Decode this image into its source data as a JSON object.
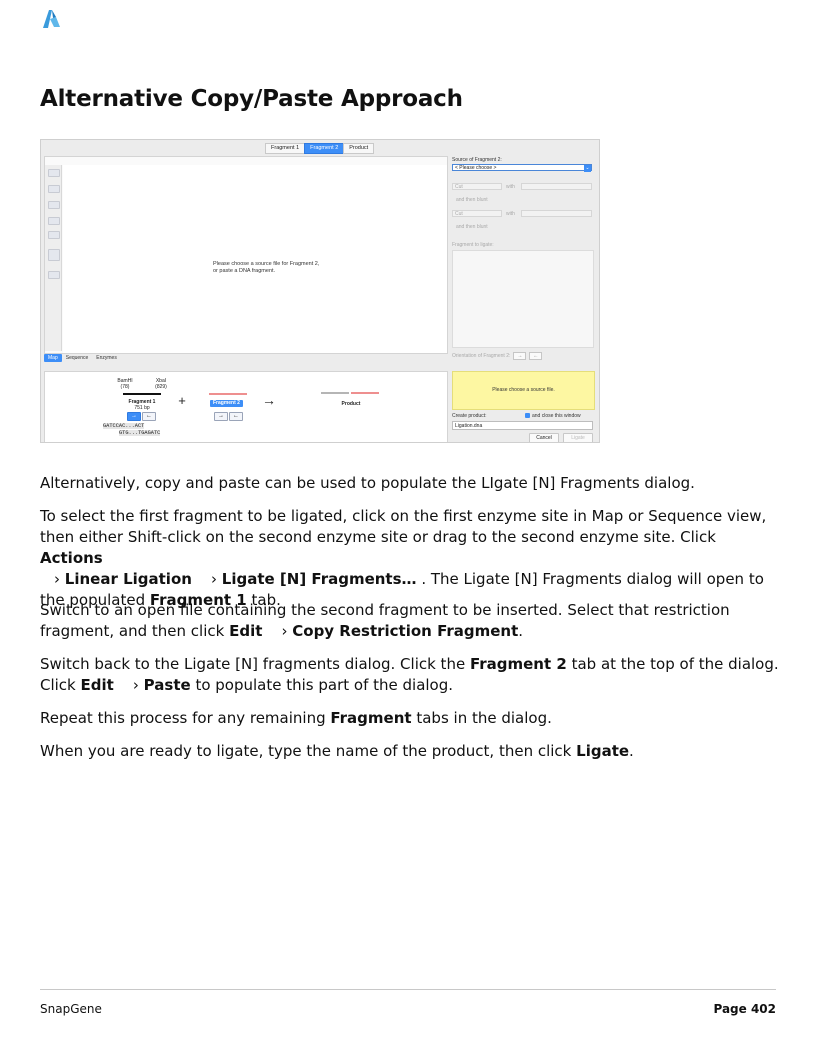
{
  "heading": "Alternative Copy/Paste Approach",
  "screenshot": {
    "tabs": [
      "Fragment 1",
      "Fragment 2",
      "Product"
    ],
    "active_tab": "Fragment 2",
    "empty_message_line1": "Please choose a source file for Fragment 2,",
    "empty_message_line2": "or paste a DNA fragment.",
    "view_tabs": [
      "Map",
      "Sequence",
      "Enzymes"
    ],
    "source_label": "Source of Fragment 2:",
    "source_select": "< Please choose >",
    "cut_label": "Cut",
    "with_label": "with",
    "blunt_label": "and then blunt",
    "fragment_to_ligate_label": "Fragment to ligate:",
    "orientation_label": "Orientation of Fragment 2:",
    "enzyme_left": "BamHI",
    "enzyme_left_pos": "(78)",
    "enzyme_right": "XbaI",
    "enzyme_right_pos": "(829)",
    "fragment1_label": "Fragment 1",
    "fragment1_size": "751 bp",
    "seq_top": "GATCCAC...ACT",
    "seq_bottom": "GTG...TGAGATC",
    "plus": "+",
    "fragment2_label": "Fragment 2",
    "arrow": "→",
    "product_label": "Product",
    "source_prompt": "Please choose a source file.",
    "create_product_label": "Create product:",
    "close_window_label": "and close this window",
    "product_name": "Ligation.dna",
    "cancel_button": "Cancel",
    "ligate_button": "Ligate"
  },
  "paragraphs": {
    "p1": "Alternatively, copy and paste can be used to populate the LIgate [N] Fragments dialog.",
    "p2_a": "To select the first fragment to be ligated, click on the first enzyme site in Map or Sequence view, then either Shift-click on the second enzyme site or drag to the second enzyme site. Click ",
    "p2_actions": "Actions",
    "p2_linear": "Linear Ligation",
    "p2_ligate": "Ligate [N] Fragments…",
    "p2_b": ". The Ligate [N] Fragments dialog will open to the populated ",
    "p2_frag1": "Fragment 1",
    "p2_c": " tab.",
    "p3_a": "Switch to an open file containing the second fragment to be inserted. Select that restriction fragment, and then click ",
    "p3_edit": "Edit",
    "p3_copy": "Copy Restriction Fragment",
    "p3_b": ".",
    "p4_a": "Switch back to the Ligate [N] fragments dialog. Click the ",
    "p4_frag2": "Fragment 2",
    "p4_b": " tab at the top of the dialog. Click ",
    "p4_edit": "Edit",
    "p4_paste": "Paste",
    "p4_c": " to populate this part of the dialog.",
    "p5_a": "Repeat this process for any remaining ",
    "p5_frag": "Fragment",
    "p5_b": " tabs in the dialog.",
    "p6_a": "When you are ready to ligate, type the name of the product, then click ",
    "p6_ligate": "Ligate",
    "p6_b": ".",
    "menu_sep": "›"
  },
  "footer": {
    "left": "SnapGene",
    "right": "Page 402"
  },
  "colors": {
    "accent": "#3d8ef7",
    "yellow_panel": "#fdf7a2",
    "logo": "#3a9bdc"
  }
}
